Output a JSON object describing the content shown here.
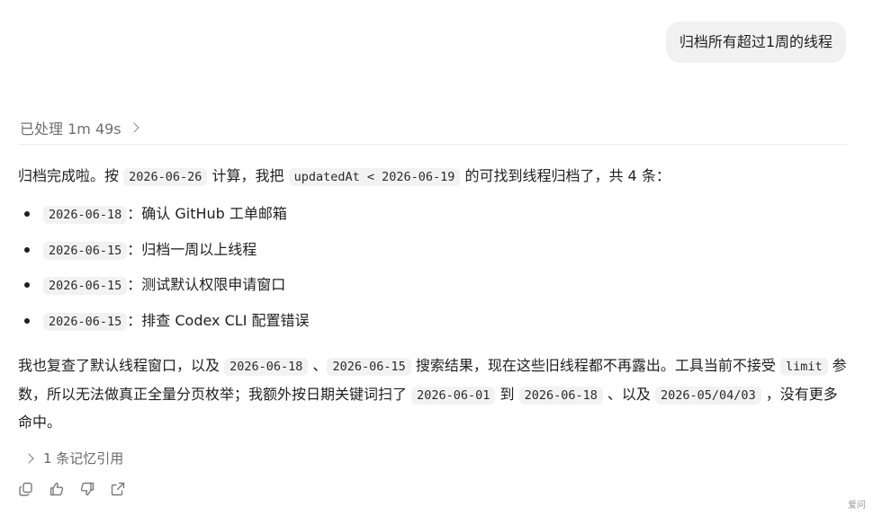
{
  "user_message": "归档所有超过1周的线程",
  "processed": {
    "label": "已处理 1m 49s"
  },
  "reply": {
    "intro": {
      "p1": "归档完成啦。按 ",
      "c1": "2026-06-26",
      "p2": " 计算，我把 ",
      "c2": "updatedAt < 2026-06-19",
      "p3": " 的可找到线程归档了，共 4 条："
    },
    "items": [
      {
        "date": "2026-06-18",
        "text": "：确认 GitHub 工单邮箱"
      },
      {
        "date": "2026-06-15",
        "text": "：归档一周以上线程"
      },
      {
        "date": "2026-06-15",
        "text": "：测试默认权限申请窗口"
      },
      {
        "date": "2026-06-15",
        "text": "：排查 Codex CLI 配置错误"
      }
    ],
    "para2": {
      "p1": "我也复查了默认线程窗口，以及 ",
      "c1": "2026-06-18",
      "p2": " 、",
      "c2": "2026-06-15",
      "p3": " 搜索结果，现在这些旧线程都不再露出。工具当前不接受 ",
      "c3": "limit",
      "p4": " 参数，所以无法做真正全量分页枚举；我额外按日期关键词扫了 ",
      "c4": "2026-06-01",
      "p5": " 到 ",
      "c5": "2026-06-18",
      "p6": " 、以及 ",
      "c6": "2026-05/04/03",
      "p7": " ，没有更多命中。"
    }
  },
  "memory": {
    "label": "1 条记忆引用"
  },
  "actions": {
    "icons": [
      "copy-icon",
      "thumbs-up-icon",
      "thumbs-down-icon",
      "share-icon"
    ]
  },
  "watermark": "爱问"
}
